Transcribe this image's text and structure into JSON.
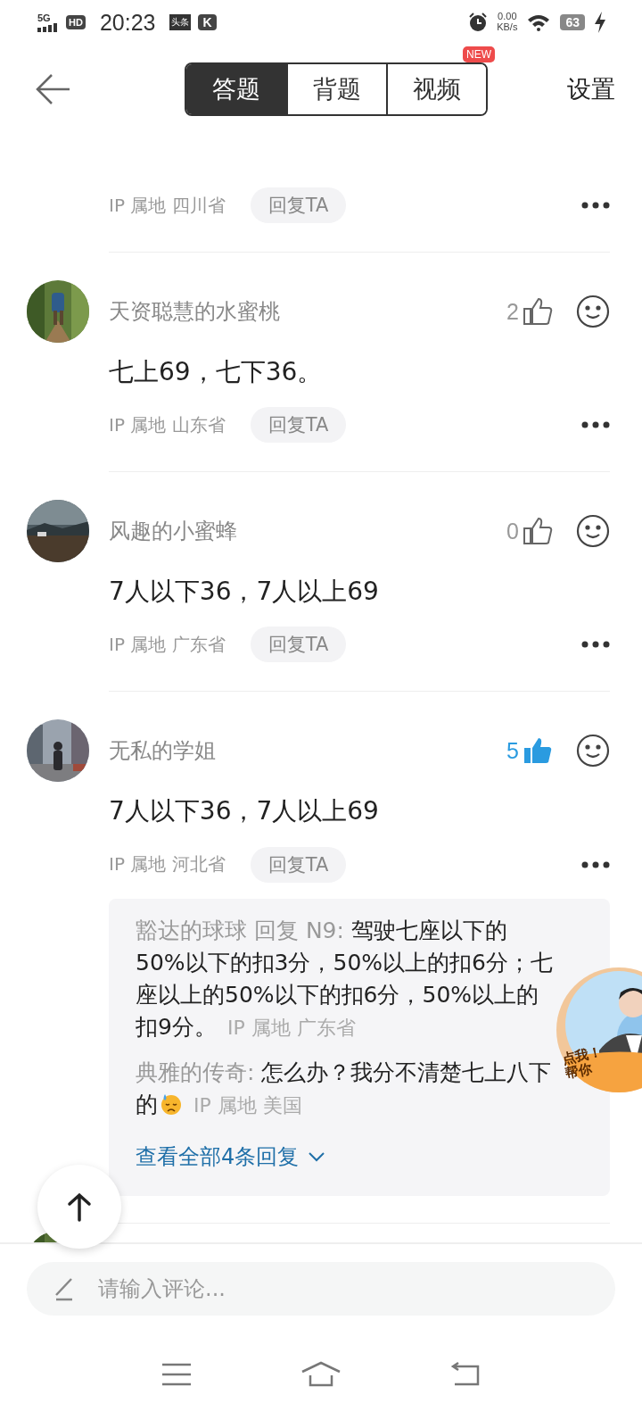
{
  "status_bar": {
    "network": "5G",
    "hd": "HD",
    "time": "20:23",
    "app_badge": "头条",
    "k_badge": "K",
    "speed": "0.00",
    "speed_unit": "KB/s",
    "battery": "63"
  },
  "header": {
    "tabs": [
      {
        "label": "答题",
        "selected": true
      },
      {
        "label": "背题",
        "selected": false
      },
      {
        "label": "视频",
        "selected": false,
        "badge": "NEW"
      }
    ],
    "settings": "设置"
  },
  "comments": [
    {
      "kind": "meta_only",
      "ip": "IP 属地 四川省",
      "reply_button": "回复TA"
    },
    {
      "kind": "full",
      "name": "天资聪慧的水蜜桃",
      "likes": "2",
      "liked": false,
      "body": "七上69，七下36。",
      "ip": "IP 属地 山东省",
      "reply_button": "回复TA"
    },
    {
      "kind": "full",
      "name": "风趣的小蜜蜂",
      "likes": "0",
      "liked": false,
      "body": "7人以下36，7人以上69",
      "ip": "IP 属地 广东省",
      "reply_button": "回复TA"
    },
    {
      "kind": "full",
      "name": "无私的学姐",
      "likes": "5",
      "liked": true,
      "body": "7人以下36，7人以上69",
      "ip": "IP 属地 河北省",
      "reply_button": "回复TA",
      "replies": [
        {
          "author": "豁达的球球 回复 N9:",
          "text": "驾驶七座以下的50%以下的扣3分，50%以上的扣6分；七座以上的50%以下的扣6分，50%以上的扣9分。",
          "ip": "IP 属地 广东省"
        },
        {
          "author": "典雅的传奇:",
          "text": "怎么办？我分不清楚七上八下的",
          "sweat_emoji": true,
          "ip": "IP 属地 美国"
        }
      ],
      "more_replies": "查看全部4条回复"
    },
    {
      "kind": "cut"
    }
  ],
  "tutor_badge": {
    "line1": "点我！",
    "line2": "帮你"
  },
  "comment_input": {
    "placeholder": "请输入评论..."
  }
}
